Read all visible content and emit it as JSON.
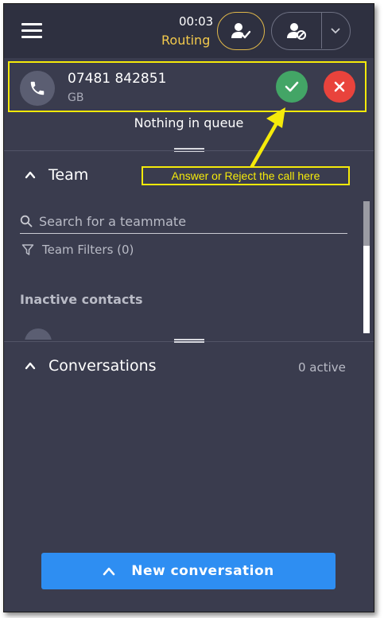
{
  "topbar": {
    "timer": "00:03",
    "status": "Routing",
    "icons": [
      "menu-icon",
      "user-check-icon",
      "user-blocked-icon",
      "chevron-down-icon"
    ]
  },
  "incoming_call": {
    "number": "07481 842851",
    "country": "GB",
    "icons": [
      "phone-icon",
      "check-icon",
      "close-icon"
    ]
  },
  "queue": {
    "status_text": "Nothing in queue"
  },
  "annotation": {
    "text": "Answer or Reject the call here"
  },
  "team": {
    "title": "Team",
    "search_placeholder": "Search for a teammate",
    "filters_label": "Team Filters (0)",
    "inactive_heading": "Inactive contacts"
  },
  "conversations": {
    "title": "Conversations",
    "active_count": "0 active"
  },
  "footer": {
    "new_conversation_label": "New conversation"
  },
  "colors": {
    "accent": "#2e8ef2",
    "accept": "#43a566",
    "reject": "#e9433c",
    "status": "#f2c94c",
    "annotation": "#f5ea0a"
  }
}
